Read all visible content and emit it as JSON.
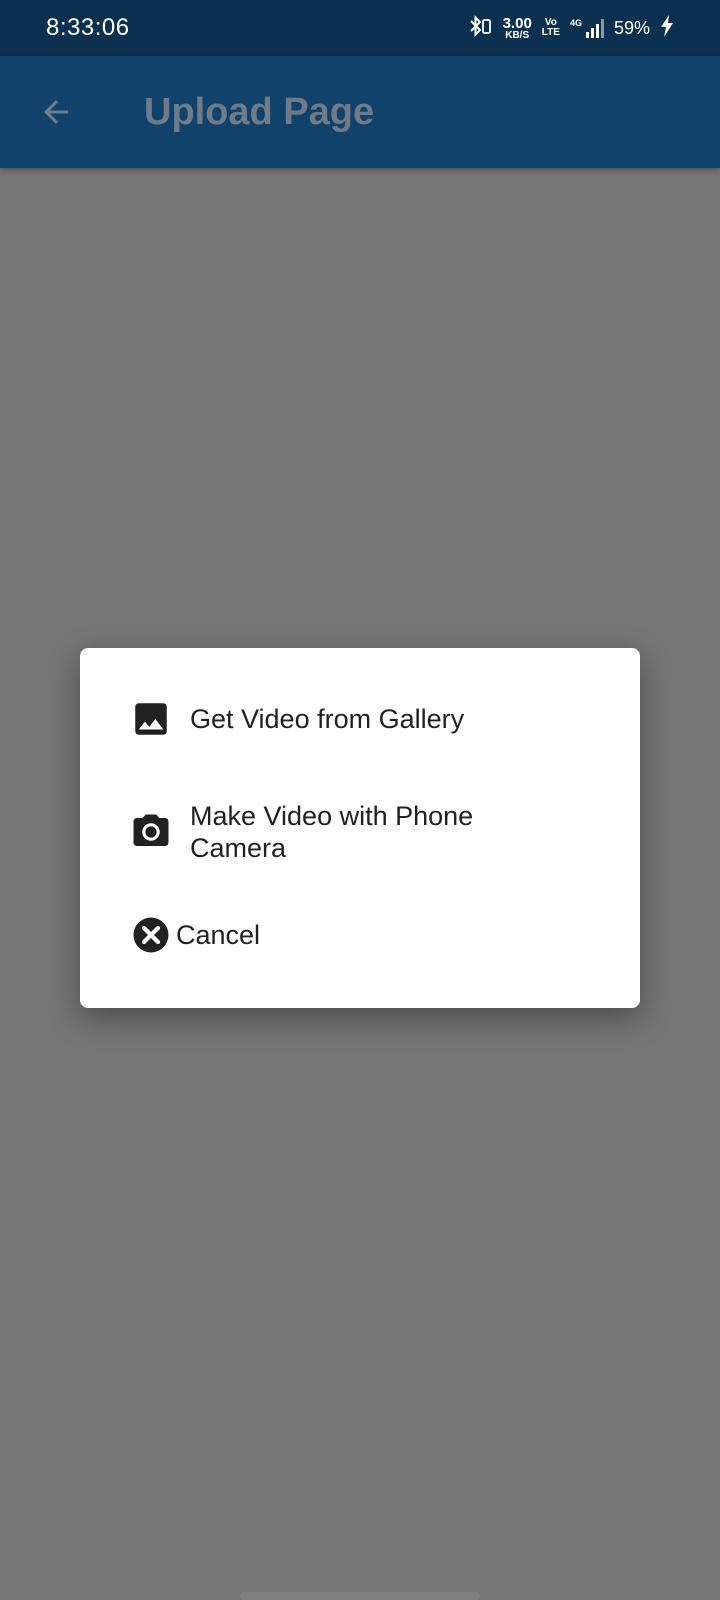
{
  "status_bar": {
    "time": "8:33:06",
    "net_speed": "3.00",
    "net_unit": "KB/S",
    "volte_top": "Vo",
    "volte_bottom": "LTE",
    "network_type": "4G",
    "battery": "59%"
  },
  "app_bar": {
    "title": "Upload Page",
    "back_icon": "arrow-back-icon"
  },
  "dialog": {
    "options": [
      {
        "label": "Get Video from Gallery",
        "icon": "image-icon"
      },
      {
        "label": "Make Video with Phone Camera",
        "icon": "camera-icon"
      },
      {
        "label": "Cancel",
        "icon": "cancel-circle-icon"
      }
    ]
  },
  "colors": {
    "status_bar": "#0b3050",
    "app_bar": "#11426c",
    "scrim": "#757575",
    "dialog": "#ffffff",
    "text": "#212121"
  }
}
